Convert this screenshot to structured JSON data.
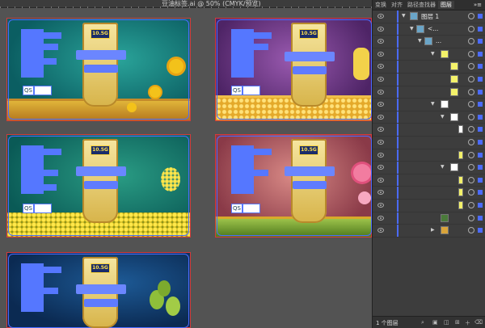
{
  "window": {
    "title": "豆油标签.ai @ 50% (CMYK/预览)"
  },
  "labels": [
    {
      "badge": "10.5G",
      "accent": "#0f7a78",
      "decor": "sunflower"
    },
    {
      "badge": "10.5G",
      "accent": "#7a3c8a",
      "decor": "corn"
    },
    {
      "badge": "10.5G",
      "accent": "#148070",
      "decor": "rapeseed"
    },
    {
      "badge": "10.5G",
      "accent": "#a04a5a",
      "decor": "peony"
    },
    {
      "badge": "10.5G",
      "accent": "#123a6e",
      "decor": "olive"
    }
  ],
  "panel": {
    "tabs": [
      "变换",
      "对齐",
      "路径查找器",
      "图层"
    ],
    "active_tab": "图层",
    "more_icon": "double-chevron-icon",
    "rows": [
      {
        "text": "图层 1",
        "indent": 0
      },
      {
        "text": "<...",
        "indent": 1
      },
      {
        "text": "...",
        "indent": 2
      }
    ],
    "footer_count": "1 个图层"
  },
  "colors": {
    "selection": "#4b6bff",
    "artboard_border": "#d43a3a"
  }
}
